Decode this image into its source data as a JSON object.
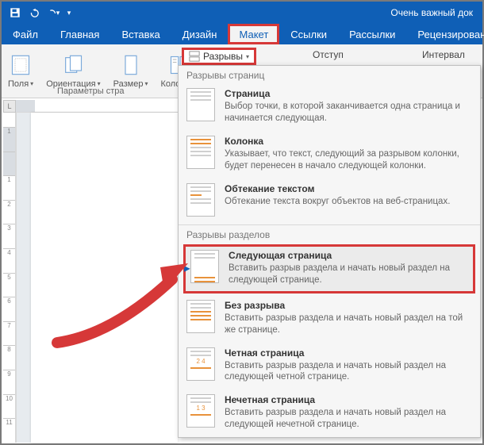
{
  "qat": {
    "title_partial": "Очень важный док"
  },
  "tabs": {
    "file": "Файл",
    "home": "Главная",
    "insert": "Вставка",
    "design": "Дизайн",
    "layout": "Макет",
    "references": "Ссылки",
    "mailings": "Рассылки",
    "review": "Рецензирование"
  },
  "ribbon": {
    "margins": "Поля",
    "orientation": "Ориентация",
    "size": "Размер",
    "columns": "Колонки",
    "group_caption_partial": "Параметры стра",
    "breaks_button": "Разрывы",
    "indent_label": "Отступ",
    "spacing_label": "Интервал"
  },
  "dropdown": {
    "section_pages": "Разрывы страниц",
    "page": {
      "title": "Страница",
      "desc": "Выбор точки, в которой заканчивается одна страница и начинается следующая."
    },
    "column": {
      "title": "Колонка",
      "desc": "Указывает, что текст, следующий за разрывом колонки, будет перенесен в начало следующей колонки."
    },
    "textwrap": {
      "title": "Обтекание текстом",
      "desc": "Обтекание текста вокруг объектов на веб-страницах."
    },
    "section_breaks": "Разрывы разделов",
    "nextpage": {
      "title": "Следующая страница",
      "desc": "Вставить разрыв раздела и начать новый раздел на следующей странице."
    },
    "continuous": {
      "title": "Без разрыва",
      "desc": "Вставить разрыв раздела и начать новый раздел на той же странице."
    },
    "evenpage": {
      "title": "Четная страница",
      "desc": "Вставить разрыв раздела и начать новый раздел на следующей четной странице."
    },
    "oddpage": {
      "title": "Нечетная страница",
      "desc": "Вставить разрыв раздела и начать новый раздел на следующей нечетной странице."
    }
  },
  "ruler_marks": [
    "1",
    "",
    "1",
    "2",
    "3",
    "4",
    "5",
    "6",
    "7",
    "8",
    "9",
    "10",
    "11"
  ],
  "corner_mark": "L",
  "colors": {
    "accent": "#0f5fb6",
    "highlight": "#d63838"
  }
}
